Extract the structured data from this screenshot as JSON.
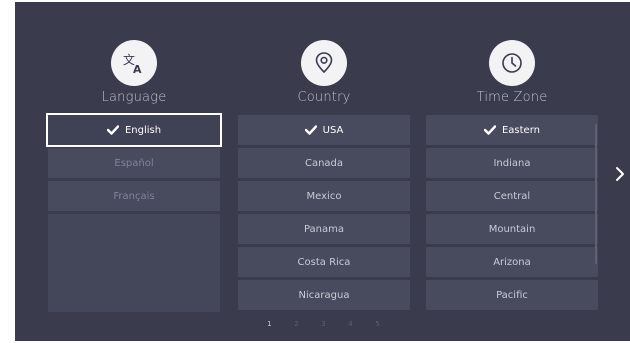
{
  "columns": [
    {
      "title": "Language",
      "icon": "translate-icon",
      "items": [
        {
          "label": "English",
          "selected": true
        },
        {
          "label": "Español",
          "selected": false
        },
        {
          "label": "Français",
          "selected": false
        }
      ]
    },
    {
      "title": "Country",
      "icon": "location-pin-icon",
      "items": [
        {
          "label": "USA",
          "selected": true
        },
        {
          "label": "Canada",
          "selected": false
        },
        {
          "label": "Mexico",
          "selected": false
        },
        {
          "label": "Panama",
          "selected": false
        },
        {
          "label": "Costa Rica",
          "selected": false
        },
        {
          "label": "Nicaragua",
          "selected": false
        }
      ]
    },
    {
      "title": "Time Zone",
      "icon": "clock-icon",
      "items": [
        {
          "label": "Eastern",
          "selected": true
        },
        {
          "label": "Indiana",
          "selected": false
        },
        {
          "label": "Central",
          "selected": false
        },
        {
          "label": "Mountain",
          "selected": false
        },
        {
          "label": "Arizona",
          "selected": false
        },
        {
          "label": "Pacific",
          "selected": false
        }
      ]
    }
  ],
  "pagination": {
    "pages": [
      "1",
      "2",
      "3",
      "4",
      "5"
    ],
    "current": "1"
  },
  "colors": {
    "background": "#3a3c4e",
    "tile": "#484a5e",
    "text": "#c9cbd6",
    "focus": "#ffffff"
  }
}
